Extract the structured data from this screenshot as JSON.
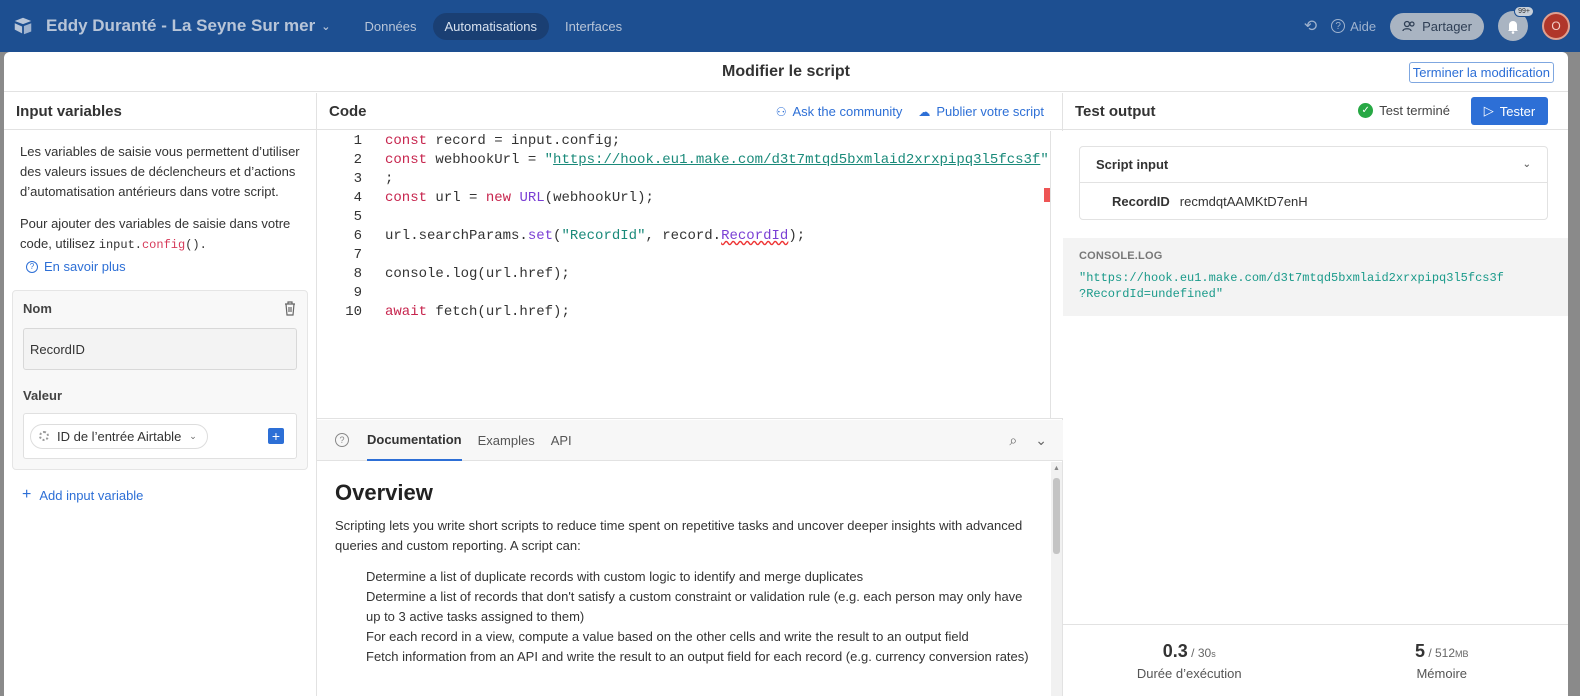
{
  "topbar": {
    "base_name": "Eddy Duranté - La Seyne Sur mer",
    "nav": [
      "Données",
      "Automatisations",
      "Interfaces"
    ],
    "active_nav": "Automatisations",
    "help_label": "Aide",
    "share_label": "Partager",
    "notifications_badge": "99+",
    "avatar_initial": "O"
  },
  "modal": {
    "title": "Modifier le script",
    "finish_label": "Terminer la modification"
  },
  "left": {
    "title": "Input variables",
    "desc1": "Les variables de saisie vous permettent d’utiliser des valeurs issues de déclencheurs et d’actions d’automatisation antérieurs dans votre script.",
    "desc2_prefix": "Pour ajouter des variables de saisie dans votre code, utilisez ",
    "desc2_code_obj": "input.",
    "desc2_code_fn": "config",
    "desc2_code_end": "().",
    "learn_more": "En savoir plus",
    "name_label": "Nom",
    "name_value": "RecordID",
    "value_label": "Valeur",
    "value_pill": "ID de l’entrée Airtable",
    "add_variable": "Add input variable"
  },
  "code": {
    "title": "Code",
    "ask_community": "Ask the community",
    "publish": "Publier votre script",
    "line_numbers": [
      "1",
      "2",
      "3",
      "4",
      "5",
      "6",
      "7",
      "8",
      "9",
      "10"
    ],
    "lines": {
      "l1_kw": "const",
      "l1_rest": " record = input.config;",
      "l2_kw": "const",
      "l2_mid": " webhookUrl = ",
      "l2_q1": "\"",
      "l2_url": "https://hook.eu1.make.com/d3t7mtqd5bxmlaid2xrxpipq3l5fcs3f",
      "l2_q2": "\"",
      "l3": ";",
      "l4_kw": "const",
      "l4_mid": " url = ",
      "l4_new": "new",
      "l4_sp": " ",
      "l4_fn": "URL",
      "l4_rest": "(webhookUrl);",
      "l6_a": "url.searchParams.",
      "l6_fn": "set",
      "l6_b": "(",
      "l6_str": "\"RecordId\"",
      "l6_c": ", record.",
      "l6_prop": "RecordId",
      "l6_d": ");",
      "l8": "console.log(url.href);",
      "l10_kw": "await",
      "l10_rest": " fetch(url.href);"
    }
  },
  "docs": {
    "tabs": [
      "Documentation",
      "Examples",
      "API"
    ],
    "active_tab": "Documentation",
    "heading": "Overview",
    "intro": "Scripting lets you write short scripts to reduce time spent on repetitive tasks and uncover deeper insights with advanced queries and custom reporting. A script can:",
    "items": [
      "Determine a list of duplicate records with custom logic to identify and merge duplicates",
      "Determine a list of records that don't satisfy a custom constraint or validation rule (e.g. each person may only have up to 3 active tasks assigned to them)",
      "For each record in a view, compute a value based on the other cells and write the result to an output field",
      "Fetch information from an API and write the result to an output field for each record (e.g. currency conversion rates)"
    ]
  },
  "output": {
    "title": "Test output",
    "status": "Test terminé",
    "tester_label": "Tester",
    "script_input_title": "Script input",
    "input_key": "RecordID",
    "input_value": "recmdqtAAMKtD7enH",
    "console_title": "CONSOLE.LOG",
    "console_line1": "\"https://hook.eu1.make.com/d3t7mtqd5bxmlaid2xrxpipq3l5fcs3f",
    "console_line2": "?RecordId=undefined\"",
    "duration_value": "0.3",
    "duration_max": " / 30",
    "duration_unit": "s",
    "duration_label": "Durée d’exécution",
    "memory_value": "5",
    "memory_max": " / 512",
    "memory_unit": "MB",
    "memory_label": "Mémoire"
  },
  "colors": {
    "topbar": "#1d4f91",
    "accent": "#2d6fd6",
    "success": "#27a844"
  }
}
